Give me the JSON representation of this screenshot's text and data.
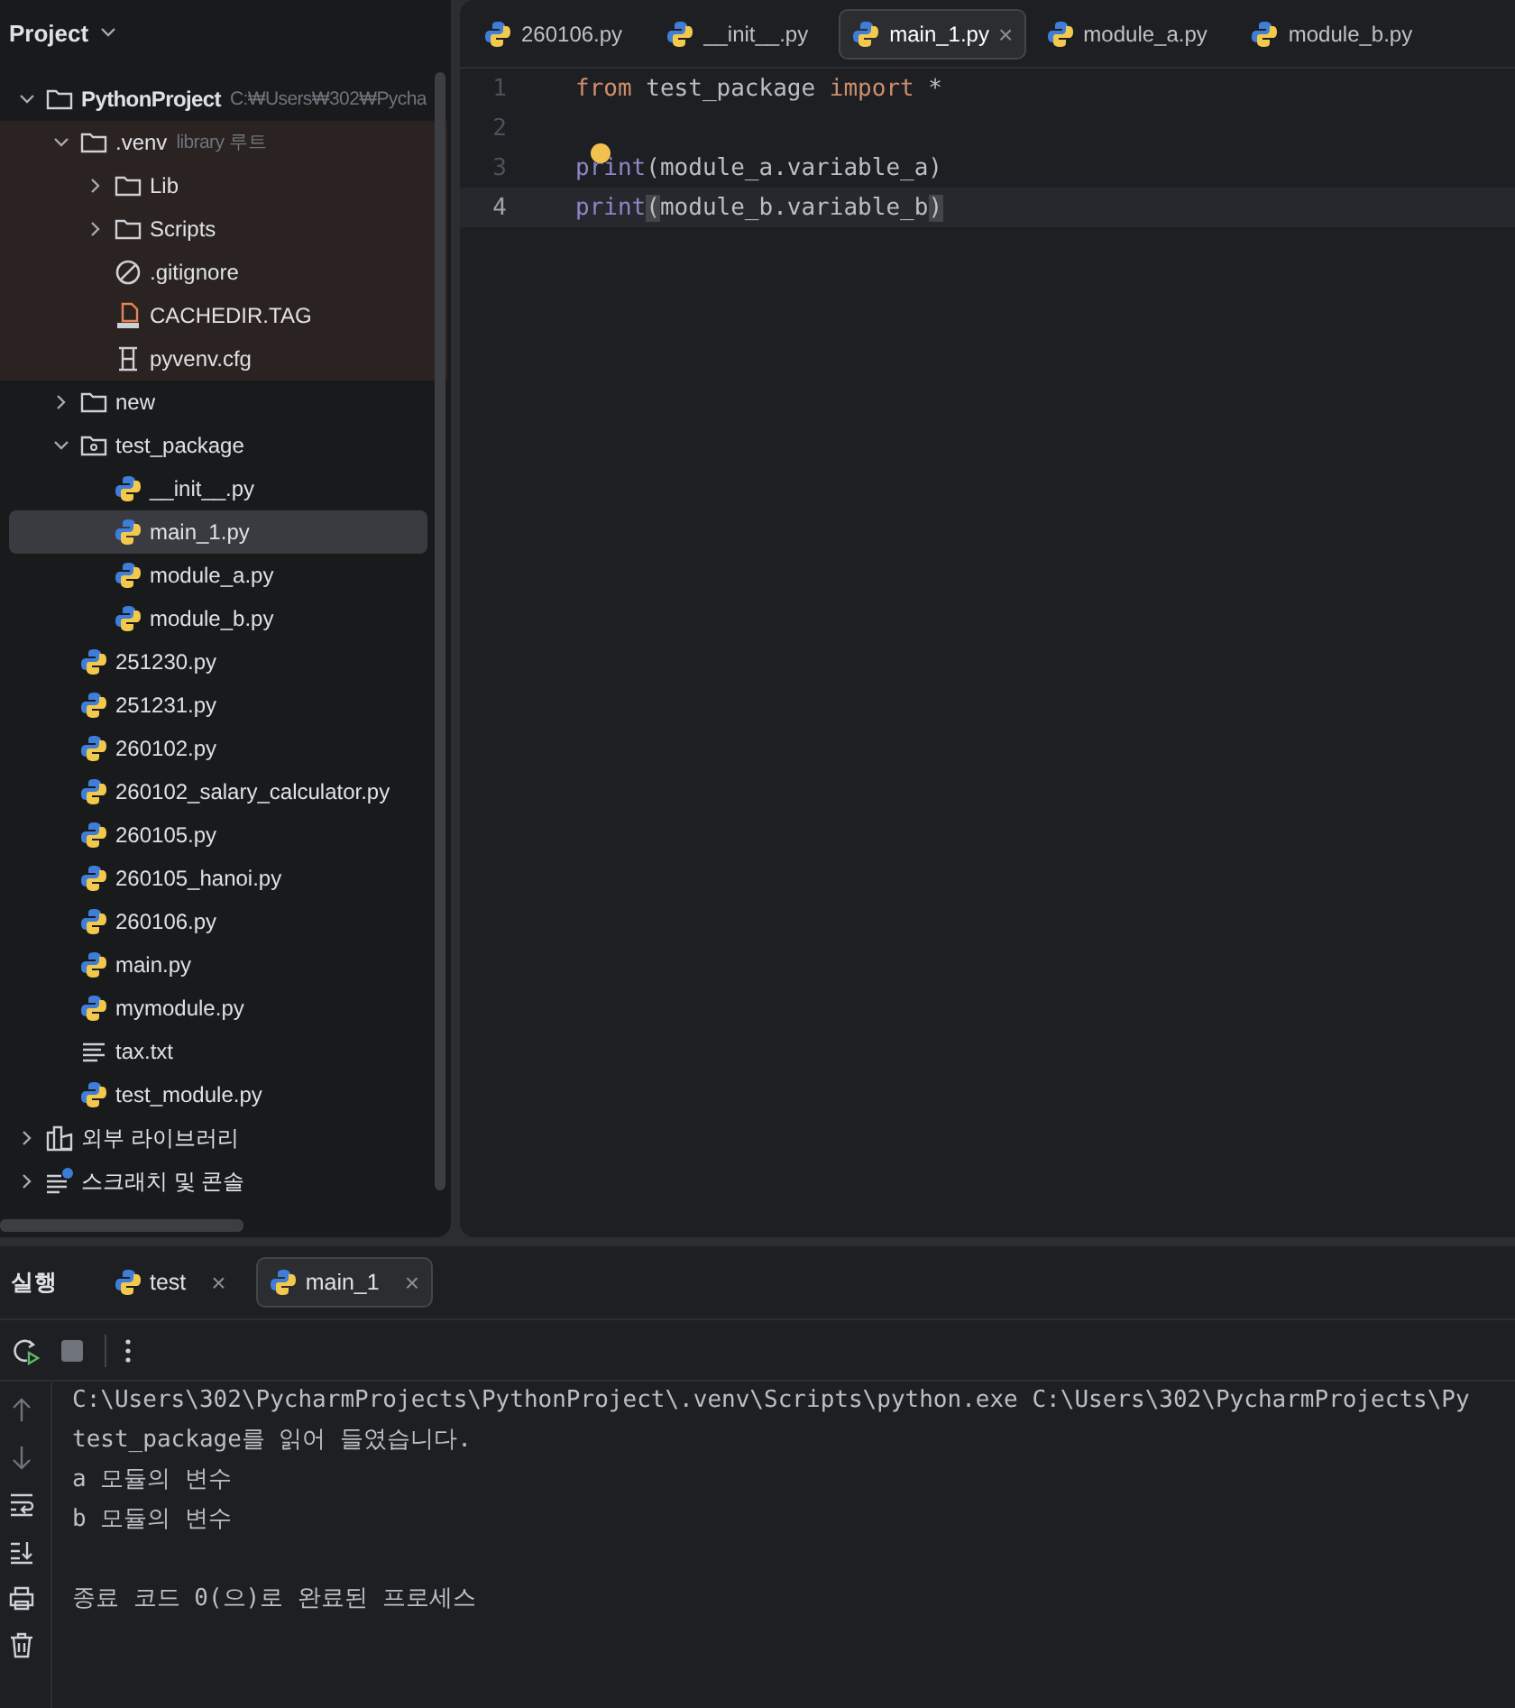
{
  "project_panel": {
    "title": "Project",
    "tree": [
      {
        "name": "PythonProject",
        "hint": "C:₩Users₩302₩Pycha",
        "kind": "folder",
        "bold": true,
        "expanded": true,
        "selected": false,
        "children": [
          {
            "name": ".venv",
            "hint": "library 루트",
            "kind": "folder",
            "excluded": true,
            "expanded": true,
            "selected": false,
            "children": [
              {
                "name": "Lib",
                "kind": "folder",
                "expanded": false,
                "selected": false
              },
              {
                "name": "Scripts",
                "kind": "folder",
                "expanded": false,
                "selected": false
              },
              {
                "name": ".gitignore",
                "kind": "ignore",
                "selected": false
              },
              {
                "name": "CACHEDIR.TAG",
                "kind": "tag",
                "selected": false
              },
              {
                "name": "pyvenv.cfg",
                "kind": "config",
                "selected": false
              }
            ]
          },
          {
            "name": "new",
            "kind": "folder",
            "expanded": false,
            "selected": false
          },
          {
            "name": "test_package",
            "kind": "package",
            "expanded": true,
            "selected": false,
            "children": [
              {
                "name": "__init__.py",
                "kind": "python",
                "selected": false
              },
              {
                "name": "main_1.py",
                "kind": "python",
                "selected": true
              },
              {
                "name": "module_a.py",
                "kind": "python",
                "selected": false
              },
              {
                "name": "module_b.py",
                "kind": "python",
                "selected": false
              }
            ]
          },
          {
            "name": "251230.py",
            "kind": "python",
            "selected": false
          },
          {
            "name": "251231.py",
            "kind": "python",
            "selected": false
          },
          {
            "name": "260102.py",
            "kind": "python",
            "selected": false
          },
          {
            "name": "260102_salary_calculator.py",
            "kind": "python",
            "selected": false
          },
          {
            "name": "260105.py",
            "kind": "python",
            "selected": false
          },
          {
            "name": "260105_hanoi.py",
            "kind": "python",
            "selected": false
          },
          {
            "name": "260106.py",
            "kind": "python",
            "selected": false
          },
          {
            "name": "main.py",
            "kind": "python",
            "selected": false
          },
          {
            "name": "mymodule.py",
            "kind": "python",
            "selected": false
          },
          {
            "name": "tax.txt",
            "kind": "text",
            "selected": false
          },
          {
            "name": "test_module.py",
            "kind": "python",
            "selected": false
          }
        ]
      },
      {
        "name": "외부 라이브러리",
        "kind": "library",
        "expanded": false,
        "selected": false
      },
      {
        "name": "스크래치 및 콘솔",
        "kind": "scratch",
        "expanded": false,
        "selected": false
      }
    ]
  },
  "editor": {
    "tabs": [
      {
        "label": "260106.py",
        "selected": false
      },
      {
        "label": "__init__.py",
        "selected": false
      },
      {
        "label": "main_1.py",
        "selected": true,
        "close": "×"
      },
      {
        "label": "module_a.py",
        "selected": false
      },
      {
        "label": "module_b.py",
        "selected": false
      }
    ],
    "lines": [
      {
        "number": "1",
        "current": false,
        "tokens": [
          {
            "text": "from",
            "kind": "keyword"
          },
          {
            "text": " test_package ",
            "kind": "plain"
          },
          {
            "text": "import",
            "kind": "keyword"
          },
          {
            "text": " *",
            "kind": "plain"
          }
        ]
      },
      {
        "number": "2",
        "current": false
      },
      {
        "number": "3",
        "current": false,
        "bulb": true,
        "tokens": [
          {
            "text": "print",
            "kind": "builtin"
          },
          {
            "text": "(module_a.variable_a)",
            "kind": "plain"
          }
        ]
      },
      {
        "number": "4",
        "current": true,
        "tokens": [
          {
            "text": "print",
            "kind": "builtin"
          },
          {
            "text": "(",
            "kind": "brace"
          },
          {
            "text": "module_b.variable_b",
            "kind": "plain"
          },
          {
            "text": ")",
            "kind": "brace"
          }
        ]
      }
    ]
  },
  "run_panel": {
    "title": "실행",
    "tabs": [
      {
        "label": "test",
        "close": "×",
        "selected": false
      },
      {
        "label": "main_1",
        "close": "×",
        "selected": true
      }
    ],
    "console": [
      {
        "text": "C:\\Users\\302\\PycharmProjects\\PythonProject\\.venv\\Scripts\\python.exe C:\\Users\\302\\PycharmProjects\\Py",
        "kind": "command"
      },
      {
        "text": "test_package를 읽어 들였습니다.",
        "kind": "output"
      },
      {
        "text": "a 모듈의 변수",
        "kind": "output"
      },
      {
        "text": "b 모듈의 변수",
        "kind": "output"
      },
      {
        "text": "종료 코드 0(으)로 완료된 프로세스",
        "kind": "exit"
      }
    ]
  }
}
